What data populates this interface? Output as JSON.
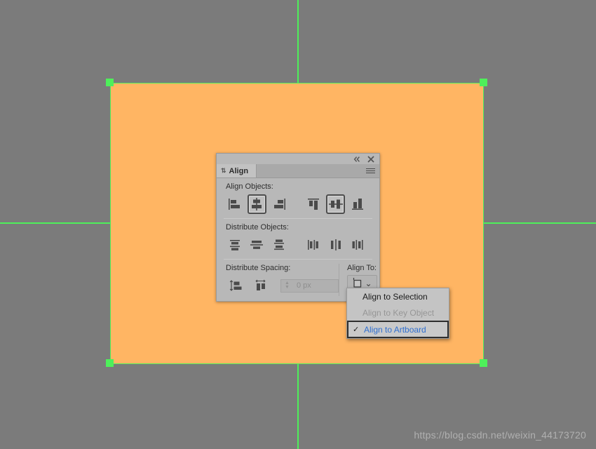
{
  "app": {
    "background_color": "#7b7b7b",
    "shape_color": "#ffb563",
    "guide_color": "#4ef05a",
    "handle_color": "#4ef05a"
  },
  "panel": {
    "titlebar": {
      "collapse_label": "«",
      "close_label": "✖"
    },
    "tab_label": "Align",
    "tab_dock_glyph": "⇅",
    "menu_icon_name": "panel-menu-icon",
    "sections": {
      "align_objects": {
        "label": "Align Objects:",
        "buttons": [
          {
            "name": "horizontal-align-left",
            "selected": false
          },
          {
            "name": "horizontal-align-center",
            "selected": true
          },
          {
            "name": "horizontal-align-right",
            "selected": false
          },
          {
            "name": "vertical-align-top",
            "selected": false
          },
          {
            "name": "vertical-align-center",
            "selected": true
          },
          {
            "name": "vertical-align-bottom",
            "selected": false
          }
        ]
      },
      "distribute_objects": {
        "label": "Distribute Objects:",
        "buttons": [
          {
            "name": "vertical-distribute-top",
            "selected": false
          },
          {
            "name": "vertical-distribute-center",
            "selected": false
          },
          {
            "name": "vertical-distribute-bottom",
            "selected": false
          },
          {
            "name": "horizontal-distribute-left",
            "selected": false
          },
          {
            "name": "horizontal-distribute-center",
            "selected": false
          },
          {
            "name": "horizontal-distribute-right",
            "selected": false
          }
        ]
      },
      "distribute_spacing": {
        "label": "Distribute Spacing:",
        "buttons": [
          {
            "name": "vertical-distribute-space",
            "selected": false
          },
          {
            "name": "horizontal-distribute-space",
            "selected": false
          }
        ],
        "spacing_value": "0 px",
        "spacing_placeholder": "0 px",
        "spacing_enabled": false
      },
      "align_to": {
        "label": "Align To:",
        "selected_value": "Align to Artboard",
        "button_icon": "artboard-icon",
        "chevron": "⌄"
      }
    }
  },
  "align_to_menu": {
    "items": [
      {
        "label": "Align to Selection",
        "checked": false,
        "disabled": false
      },
      {
        "label": "Align to Key Object",
        "checked": false,
        "disabled": true
      },
      {
        "label": "Align to Artboard",
        "checked": true,
        "disabled": false
      }
    ],
    "check_glyph": "✓",
    "highlight_color": "#2f6fd0"
  },
  "watermark": {
    "text": "https://blog.csdn.net/weixin_44173720"
  }
}
